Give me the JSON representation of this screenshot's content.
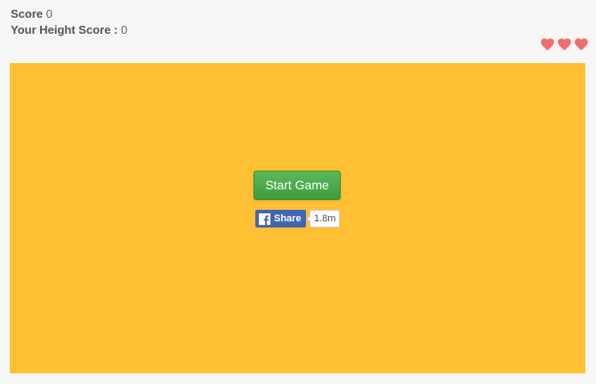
{
  "hud": {
    "score_label": "Score",
    "score_value": "0",
    "height_score_label": "Your Height Score :",
    "height_score_value": "0",
    "lives": 3,
    "heart_color": "#f06d6d",
    "heart_icon": "heart-icon"
  },
  "game": {
    "background_color": "#ffc033",
    "start_button_label": "Start Game",
    "start_button_color": "#4cae4c"
  },
  "share": {
    "icon": "facebook-icon",
    "button_label": "Share",
    "count": "1.8m",
    "brand_color": "#4267b2"
  }
}
